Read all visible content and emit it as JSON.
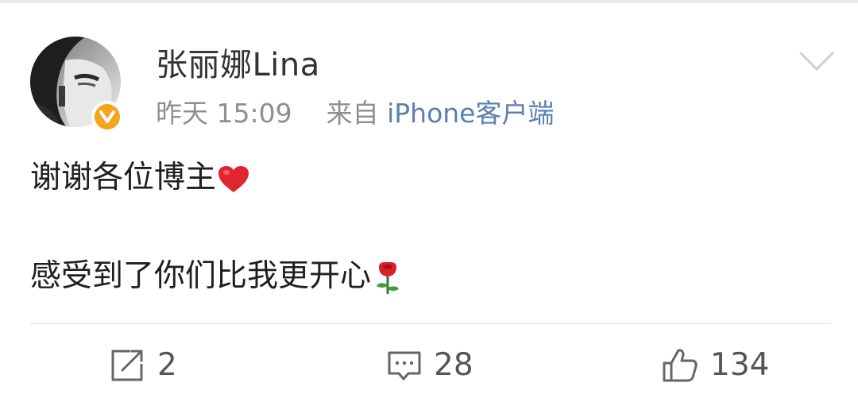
{
  "post": {
    "username": "张丽娜Lina",
    "time": "昨天 15:09",
    "source_prefix": "来自",
    "source_app": "iPhone客户端",
    "content_line1": "谢谢各位博主",
    "content_line2": "感受到了你们比我更开心",
    "emoji_line1": "heart",
    "emoji_line2": "rose"
  },
  "actions": {
    "repost_count": "2",
    "comment_count": "28",
    "like_count": "134"
  },
  "colors": {
    "username": "#333333",
    "meta": "#8f8f8f",
    "source_link": "#5b7fb3",
    "verified_badge": "#f2a51d",
    "heart": "#e0262d",
    "action_text": "#555555"
  },
  "icons": {
    "avatar": "avatar-image",
    "verified": "verified-badge-icon",
    "dropdown": "chevron-down-icon",
    "repost": "repost-icon",
    "comment": "comment-icon",
    "like": "thumbs-up-icon"
  }
}
